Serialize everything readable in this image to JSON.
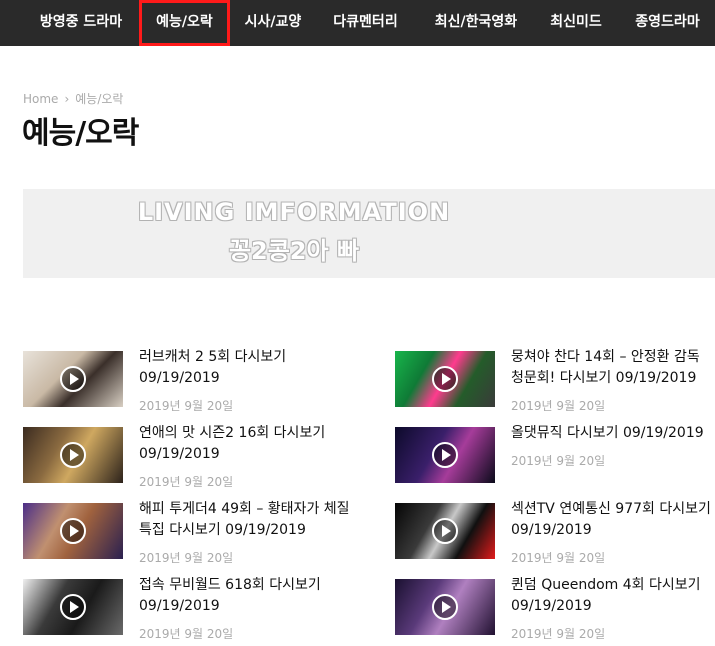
{
  "nav": {
    "items": [
      "방영중 드라마",
      "예능/오락",
      "시사/교양",
      "다큐멘터리",
      "최신/한국영화",
      "최신미드",
      "종영드라마"
    ],
    "active": "예능/오락"
  },
  "breadcrumb": {
    "home": "Home",
    "separator": "›",
    "current": "예능/오락"
  },
  "page_title": "예능/오락",
  "banner": {
    "line1": "LIVING IMFORMATION",
    "line2": "꽁2콩2아 빠"
  },
  "posts": [
    {
      "title": "러브캐처 2 5회 다시보기 09/19/2019",
      "date": "2019년 9월 20일",
      "icon": "play-icon"
    },
    {
      "title": "뭉쳐야 찬다 14회 – 안정환 감독 청문회! 다시보기 09/19/2019",
      "date": "2019년 9월 20일",
      "icon": "play-icon"
    },
    {
      "title": "연애의 맛 시즌2 16회 다시보기 09/19/2019",
      "date": "2019년 9월 20일",
      "icon": "play-icon"
    },
    {
      "title": "올댓뮤직 다시보기 09/19/2019",
      "date": "2019년 9월 20일",
      "icon": "play-icon"
    },
    {
      "title": "해피 투게더4 49회 – 황태자가 체질 특집 다시보기 09/19/2019",
      "date": "2019년 9월 20일",
      "icon": "play-icon"
    },
    {
      "title": "섹션TV 연예통신 977회 다시보기 09/19/2019",
      "date": "2019년 9월 20일",
      "icon": "play-icon"
    },
    {
      "title": "접속 무비월드 618회 다시보기 09/19/2019",
      "date": "2019년 9월 20일",
      "icon": "play-icon"
    },
    {
      "title": "퀸덤 Queendom 4회 다시보기 09/19/2019",
      "date": "2019년 9월 20일",
      "icon": "play-icon"
    }
  ],
  "colors": {
    "nav_bg": "#2a2a2a",
    "active_outline": "#ff1a1a",
    "meta_text": "#aaaaaa"
  }
}
